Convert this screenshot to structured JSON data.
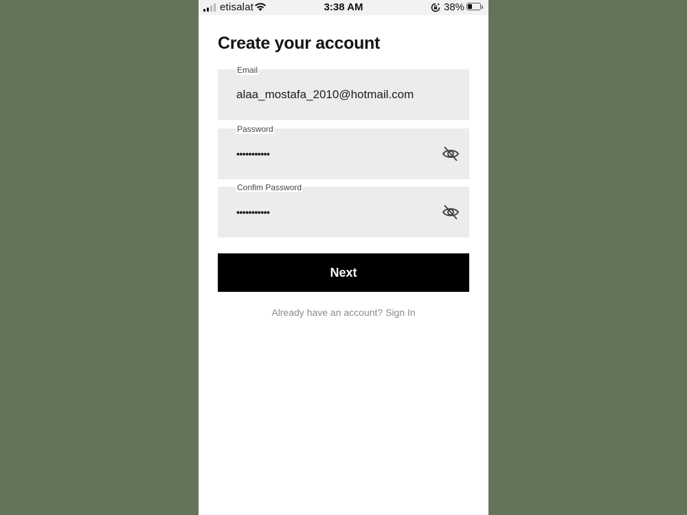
{
  "status_bar": {
    "carrier": "etisalat",
    "time": "3:38 AM",
    "battery_percent": "38%",
    "battery_level": 0.38,
    "signal_bars_filled": 2,
    "signal_bars_total": 4,
    "icons": [
      "signal-icon",
      "wifi-icon",
      "orientation-lock-icon",
      "battery-icon"
    ]
  },
  "page": {
    "title": "Create your account"
  },
  "form": {
    "email": {
      "label": "Email",
      "value": "alaa_mostafa_2010@hotmail.com"
    },
    "password": {
      "label": "Password",
      "masked_value": "•••••••••••",
      "toggle_icon": "eye-slash-icon"
    },
    "confirm_password": {
      "label": "Confim Password",
      "masked_value": "•••••••••••",
      "toggle_icon": "eye-slash-icon"
    },
    "next_label": "Next",
    "signin_prompt": "Already have an account? Sign In"
  },
  "colors": {
    "background": "#627559",
    "field_background": "#ececec",
    "button_background": "#000000",
    "button_text": "#ffffff",
    "link_text": "#8a8a8a"
  }
}
